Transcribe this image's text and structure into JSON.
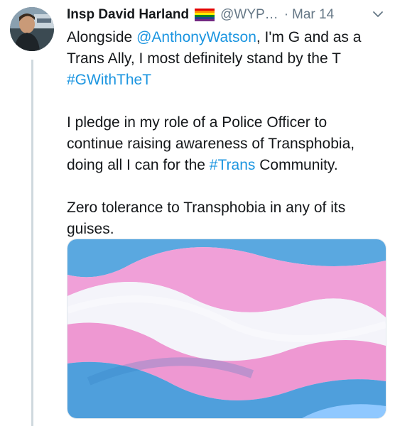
{
  "tweet": {
    "author_name": "Insp David Harland",
    "author_handle": "@WYP…",
    "date_separator": "·",
    "date": "Mar 14",
    "flag_icon": "rainbow-flag-icon",
    "menu_icon": "chevron-down-icon",
    "paragraph1": {
      "t1": "Alongside ",
      "mention": "@AnthonyWatson",
      "t2": ", I'm G and as a Trans Ally, I most definitely stand by the T ",
      "hashtag": "#GWithTheT"
    },
    "paragraph2": {
      "t1": "I pledge in my role of a Police Officer to continue raising awareness of Transphobia, doing all I can for the ",
      "hashtag": "#Trans",
      "t2": " Community."
    },
    "paragraph3": {
      "t1": "Zero tolerance to Transphobia in any of its guises."
    },
    "media": {
      "description_icon": "transgender-pride-flag-photo",
      "colors": {
        "blue": "#5aa8e0",
        "pink": "#f0a0d8",
        "white": "#f4f4fa",
        "sky": "#8fc8ff"
      }
    }
  },
  "colors": {
    "link": "#1b95e0",
    "secondary_text": "#657786",
    "thread_line": "#cfd9de"
  }
}
